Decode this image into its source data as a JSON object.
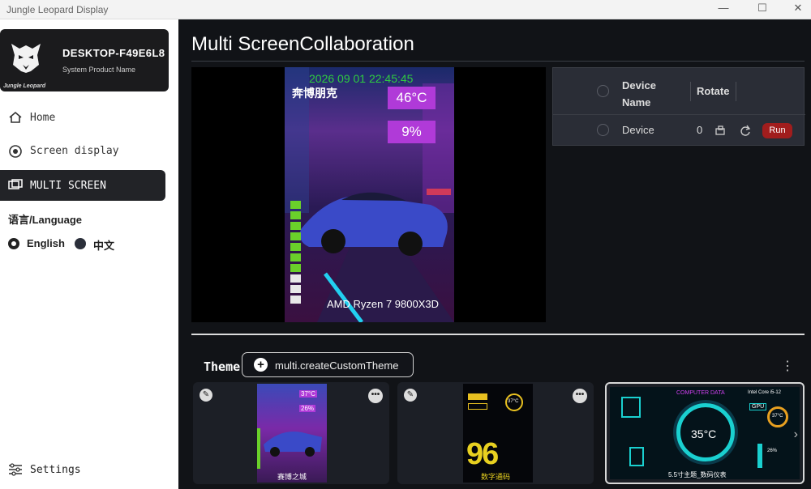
{
  "window": {
    "title": "Jungle Leopard Display"
  },
  "brand": {
    "device_name": "DESKTOP-F49E6L8",
    "subtitle": "System Product Name",
    "logo_text": "Jungle Leopard"
  },
  "nav": [
    {
      "label": "Home",
      "icon": "home-icon"
    },
    {
      "label": "Screen display",
      "icon": "display-icon"
    },
    {
      "label": "MULTI SCREEN",
      "icon": "multi-screen-icon"
    }
  ],
  "language": {
    "title": "语言/Language",
    "options": [
      {
        "label": "English",
        "selected": true
      },
      {
        "label": "中文",
        "selected": false
      }
    ]
  },
  "settings": {
    "label": "Settings",
    "icon": "settings-icon"
  },
  "page": {
    "title": "Multi ScreenCollaboration"
  },
  "preview": {
    "timestamp": "2026 09 01 22:45:45",
    "user_text": "奔博朋克",
    "temp": "46°C",
    "usage": "9%",
    "cpu": "AMD Ryzen 7 9800X3D"
  },
  "device_table": {
    "headers": {
      "device_name": "Device\nName",
      "rotate": "Rotate"
    },
    "rows": [
      {
        "device": "Device",
        "rotate": "0",
        "run_label": "Run"
      }
    ]
  },
  "theme": {
    "label": "Theme",
    "create_label": "multi.createCustomTheme"
  },
  "themes": [
    {
      "name": "",
      "temp": "37°C",
      "usage": "26%",
      "caption": "赛博之城"
    },
    {
      "temp": "37°C",
      "number": "96",
      "caption": "数字通码"
    },
    {
      "header": "COMPUTER DATA",
      "cpu_text": "Intel Core i5-12",
      "temp": "35°C",
      "caption": "5.5寸主题_数码仪表",
      "small_temp": "37°C",
      "gpu": "GPU",
      "percent": "26%"
    }
  ],
  "colors": {
    "accent_purple": "#b03ad8",
    "run_red": "#a11d1d",
    "timestamp_green": "#2ecc40"
  }
}
